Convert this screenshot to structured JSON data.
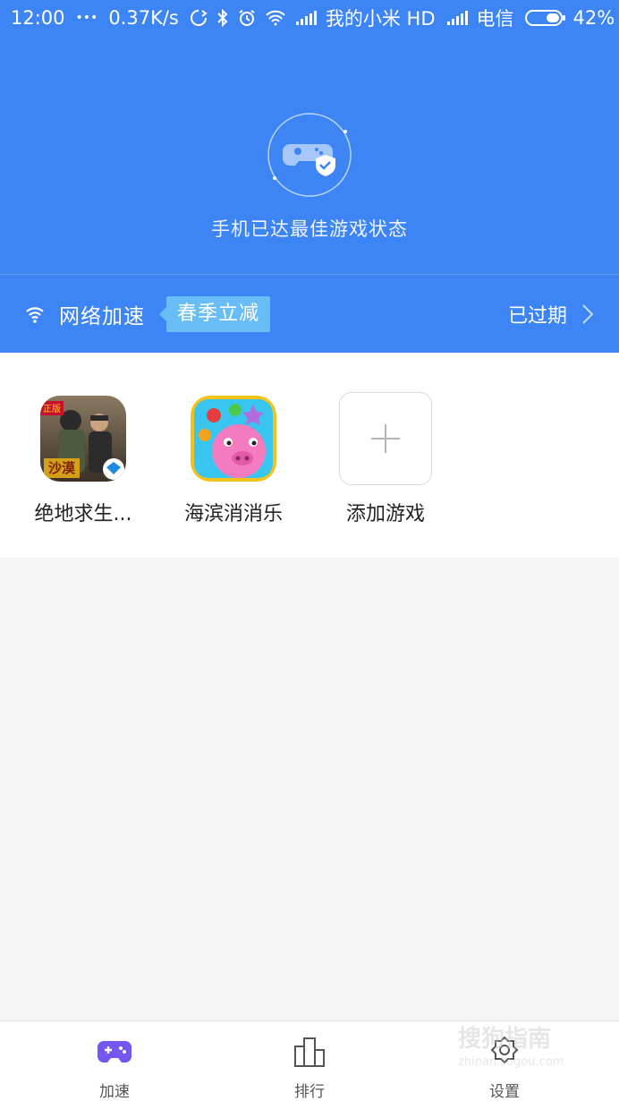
{
  "status_bar": {
    "time": "12:00",
    "dots": "•••",
    "speed": "0.37K/s",
    "carrier1": "我的小米 HD",
    "carrier2": "电信",
    "battery": "42%",
    "battery_level": 0.42
  },
  "hero": {
    "status_text": "手机已达最佳游戏状态",
    "icon": "gamepad-shield-icon"
  },
  "accel": {
    "label": "网络加速",
    "promo": "春季立减",
    "expiry": "已过期"
  },
  "games": [
    {
      "name": "绝地求生...",
      "icon": "pubg-game-icon",
      "badge_top": "正版",
      "badge_bottom": "沙漠"
    },
    {
      "name": "海滨消消乐",
      "icon": "seaside-match-game-icon"
    }
  ],
  "add_game": {
    "label": "添加游戏",
    "icon": "plus-icon"
  },
  "tabs": [
    {
      "label": "加速",
      "icon": "gamepad-icon",
      "active": true
    },
    {
      "label": "排行",
      "icon": "bar-chart-icon",
      "active": false
    },
    {
      "label": "设置",
      "icon": "gear-icon",
      "active": false
    }
  ],
  "watermark": {
    "line1": "搜狗指南",
    "line2": "zhinan.sogou.com"
  },
  "colors": {
    "primary": "#3d84f5",
    "promo": "#69bdf7",
    "active_tab": "#7457f0",
    "background": "#f5f5f5"
  }
}
